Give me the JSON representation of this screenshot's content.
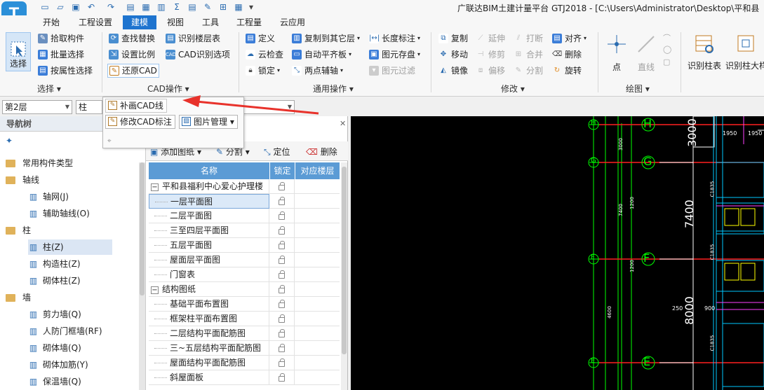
{
  "app": {
    "logo_letter": "T",
    "window_title": "广联达BIM土建计量平台 GTJ2018 - [C:\\Users\\Administrator\\Desktop\\平和县"
  },
  "menu_tabs": [
    "开始",
    "工程设置",
    "建模",
    "视图",
    "工具",
    "工程量",
    "云应用"
  ],
  "active_tab": "建模",
  "ribbon": {
    "select_group": {
      "big": "选择",
      "items": [
        "拾取构件",
        "批量选择",
        "按属性选择"
      ],
      "label": "选择"
    },
    "cad_group": {
      "items": [
        "查找替换",
        "识别楼层表",
        "设置比例",
        "CAD识别选项",
        "还原CAD"
      ],
      "label": "CAD操作"
    },
    "common_group": {
      "items": [
        "定义",
        "复制到其它层",
        "长度标注",
        "云检查",
        "自动平齐板",
        "图元存盘",
        "锁定",
        "两点辅轴",
        "图元过滤"
      ],
      "label": "通用操作"
    },
    "modify_group": {
      "items": [
        "复制",
        "延伸",
        "打断",
        "对齐",
        "移动",
        "修剪",
        "合并",
        "删除",
        "镜像",
        "偏移",
        "分割",
        "旋转"
      ],
      "label": "修改"
    },
    "draw_group": {
      "items": [
        "点",
        "直线"
      ],
      "label": "绘图"
    },
    "recognize": {
      "items": [
        "识别柱表",
        "识别柱大样"
      ]
    }
  },
  "selectors": {
    "floor": "第2层",
    "component": "柱"
  },
  "popup": {
    "items": [
      "补画CAD线",
      "修改CAD标注",
      "图片管理"
    ]
  },
  "nav": {
    "title": "导航树",
    "tree": [
      {
        "type": "folder",
        "label": "常用构件类型"
      },
      {
        "type": "folder",
        "label": "轴线"
      },
      {
        "type": "item",
        "label": "轴网(J)",
        "icon": "grid-icon"
      },
      {
        "type": "item",
        "label": "辅助轴线(O)",
        "icon": "aux-axis-icon"
      },
      {
        "type": "folder",
        "label": "柱"
      },
      {
        "type": "item",
        "label": "柱(Z)",
        "icon": "column-icon",
        "selected": true
      },
      {
        "type": "item",
        "label": "构造柱(Z)",
        "icon": "constructional-column-icon"
      },
      {
        "type": "item",
        "label": "砌体柱(Z)",
        "icon": "masonry-column-icon"
      },
      {
        "type": "folder",
        "label": "墙"
      },
      {
        "type": "item",
        "label": "剪力墙(Q)",
        "icon": "shear-wall-icon"
      },
      {
        "type": "item",
        "label": "人防门框墙(RF)",
        "icon": "door-frame-wall-icon"
      },
      {
        "type": "item",
        "label": "砌体墙(Q)",
        "icon": "masonry-wall-icon"
      },
      {
        "type": "item",
        "label": "砌体加筋(Y)",
        "icon": "masonry-rebar-icon"
      },
      {
        "type": "item",
        "label": "保温墙(Q)",
        "icon": "insulation-wall-icon"
      }
    ]
  },
  "drawings": {
    "toolbar": [
      "添加图纸",
      "分割",
      "定位",
      "删除"
    ],
    "columns": [
      "名称",
      "锁定",
      "对应楼层"
    ],
    "rows": [
      {
        "name": "平和县福利中心爱心护理楼",
        "group": true
      },
      {
        "name": "一层平面图",
        "selected": true
      },
      {
        "name": "二层平面图"
      },
      {
        "name": "三至四层平面图"
      },
      {
        "name": "五层平面图"
      },
      {
        "name": "屋面层平面图"
      },
      {
        "name": "门窗表"
      },
      {
        "name": "结构图纸",
        "group": true
      },
      {
        "name": "基础平面布置图"
      },
      {
        "name": "框架柱平面布置图"
      },
      {
        "name": "二层结构平面配筋图"
      },
      {
        "name": "三~五层结构平面配筋图"
      },
      {
        "name": "屋面结构平面配筋图"
      },
      {
        "name": "斜屋面板"
      }
    ]
  },
  "cad": {
    "axes_h": [
      "H",
      "G",
      "F",
      "E"
    ],
    "dims": [
      "3000",
      "7400",
      "8000"
    ],
    "small_dims": [
      "1950",
      "1950",
      "250",
      "900"
    ],
    "vertical_dims": [
      "3000",
      "7400",
      "4600",
      "1200",
      "1200",
      "C1835",
      "C1835",
      "C1835"
    ]
  },
  "colors": {
    "accent": "#1e74cf",
    "arrow": "#e8322b",
    "cad_bg": "#000000"
  }
}
